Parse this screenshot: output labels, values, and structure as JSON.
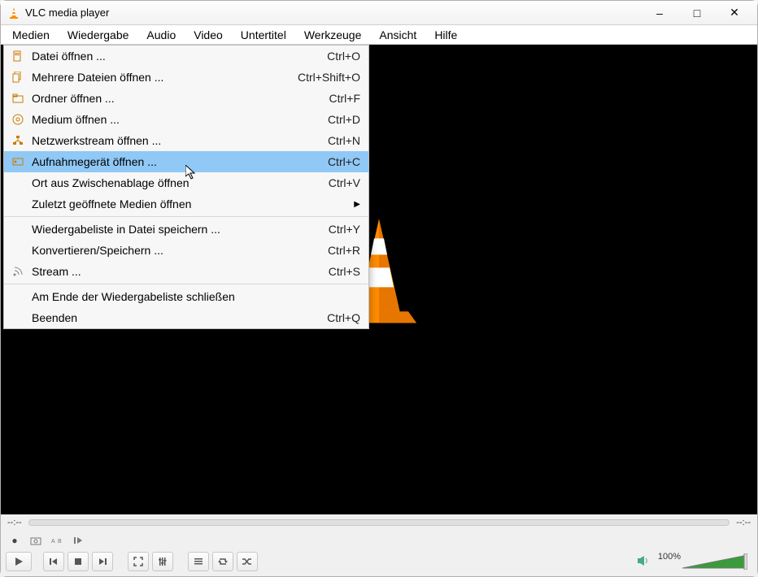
{
  "title": "VLC media player",
  "menubar": [
    "Medien",
    "Wiedergabe",
    "Audio",
    "Video",
    "Untertitel",
    "Werkzeuge",
    "Ansicht",
    "Hilfe"
  ],
  "dropdown": {
    "groups": [
      [
        {
          "icon": "file",
          "label": "Datei öffnen ...",
          "shortcut": "Ctrl+O"
        },
        {
          "icon": "files",
          "label": "Mehrere Dateien öffnen ...",
          "shortcut": "Ctrl+Shift+O"
        },
        {
          "icon": "folder",
          "label": "Ordner öffnen ...",
          "shortcut": "Ctrl+F"
        },
        {
          "icon": "disc",
          "label": "Medium öffnen ...",
          "shortcut": "Ctrl+D"
        },
        {
          "icon": "network",
          "label": "Netzwerkstream öffnen ...",
          "shortcut": "Ctrl+N"
        },
        {
          "icon": "capture",
          "label": "Aufnahmegerät öffnen ...",
          "shortcut": "Ctrl+C",
          "highlight": true
        },
        {
          "icon": "",
          "label": "Ort aus Zwischenablage öffnen",
          "shortcut": "Ctrl+V"
        },
        {
          "icon": "",
          "label": "Zuletzt geöffnete Medien öffnen",
          "shortcut": "",
          "submenu": true
        }
      ],
      [
        {
          "icon": "",
          "label": "Wiedergabeliste in Datei speichern ...",
          "shortcut": "Ctrl+Y"
        },
        {
          "icon": "",
          "label": "Konvertieren/Speichern ...",
          "shortcut": "Ctrl+R"
        },
        {
          "icon": "stream",
          "label": "Stream ...",
          "shortcut": "Ctrl+S"
        }
      ],
      [
        {
          "icon": "",
          "label": "Am Ende der Wiedergabeliste schließen",
          "shortcut": ""
        },
        {
          "icon": "",
          "label": "Beenden",
          "shortcut": "Ctrl+Q"
        }
      ]
    ]
  },
  "seek": {
    "left": "--:--",
    "right": "--:--"
  },
  "volume": {
    "percent": "100%"
  }
}
